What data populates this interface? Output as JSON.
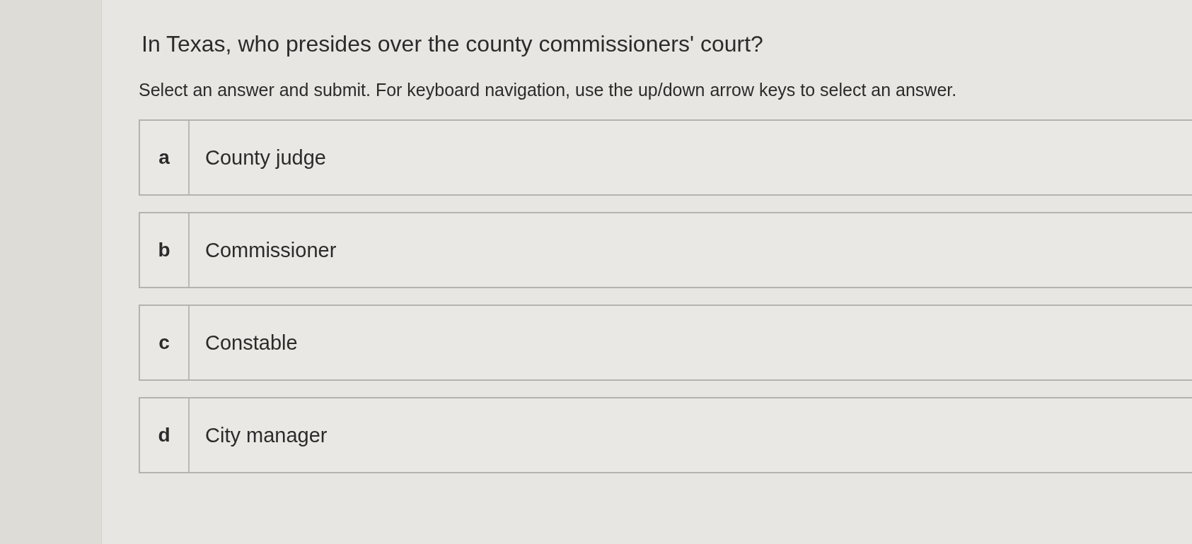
{
  "question": {
    "title": "In Texas, who presides over the county commissioners' court?",
    "instructions": "Select an answer and submit. For keyboard navigation, use the up/down arrow keys to select an answer."
  },
  "options": [
    {
      "letter": "a",
      "text": "County judge",
      "selected": false
    },
    {
      "letter": "b",
      "text": "Commissioner",
      "selected": false
    },
    {
      "letter": "c",
      "text": "Constable",
      "selected": false
    },
    {
      "letter": "d",
      "text": "City manager",
      "selected": false
    }
  ]
}
